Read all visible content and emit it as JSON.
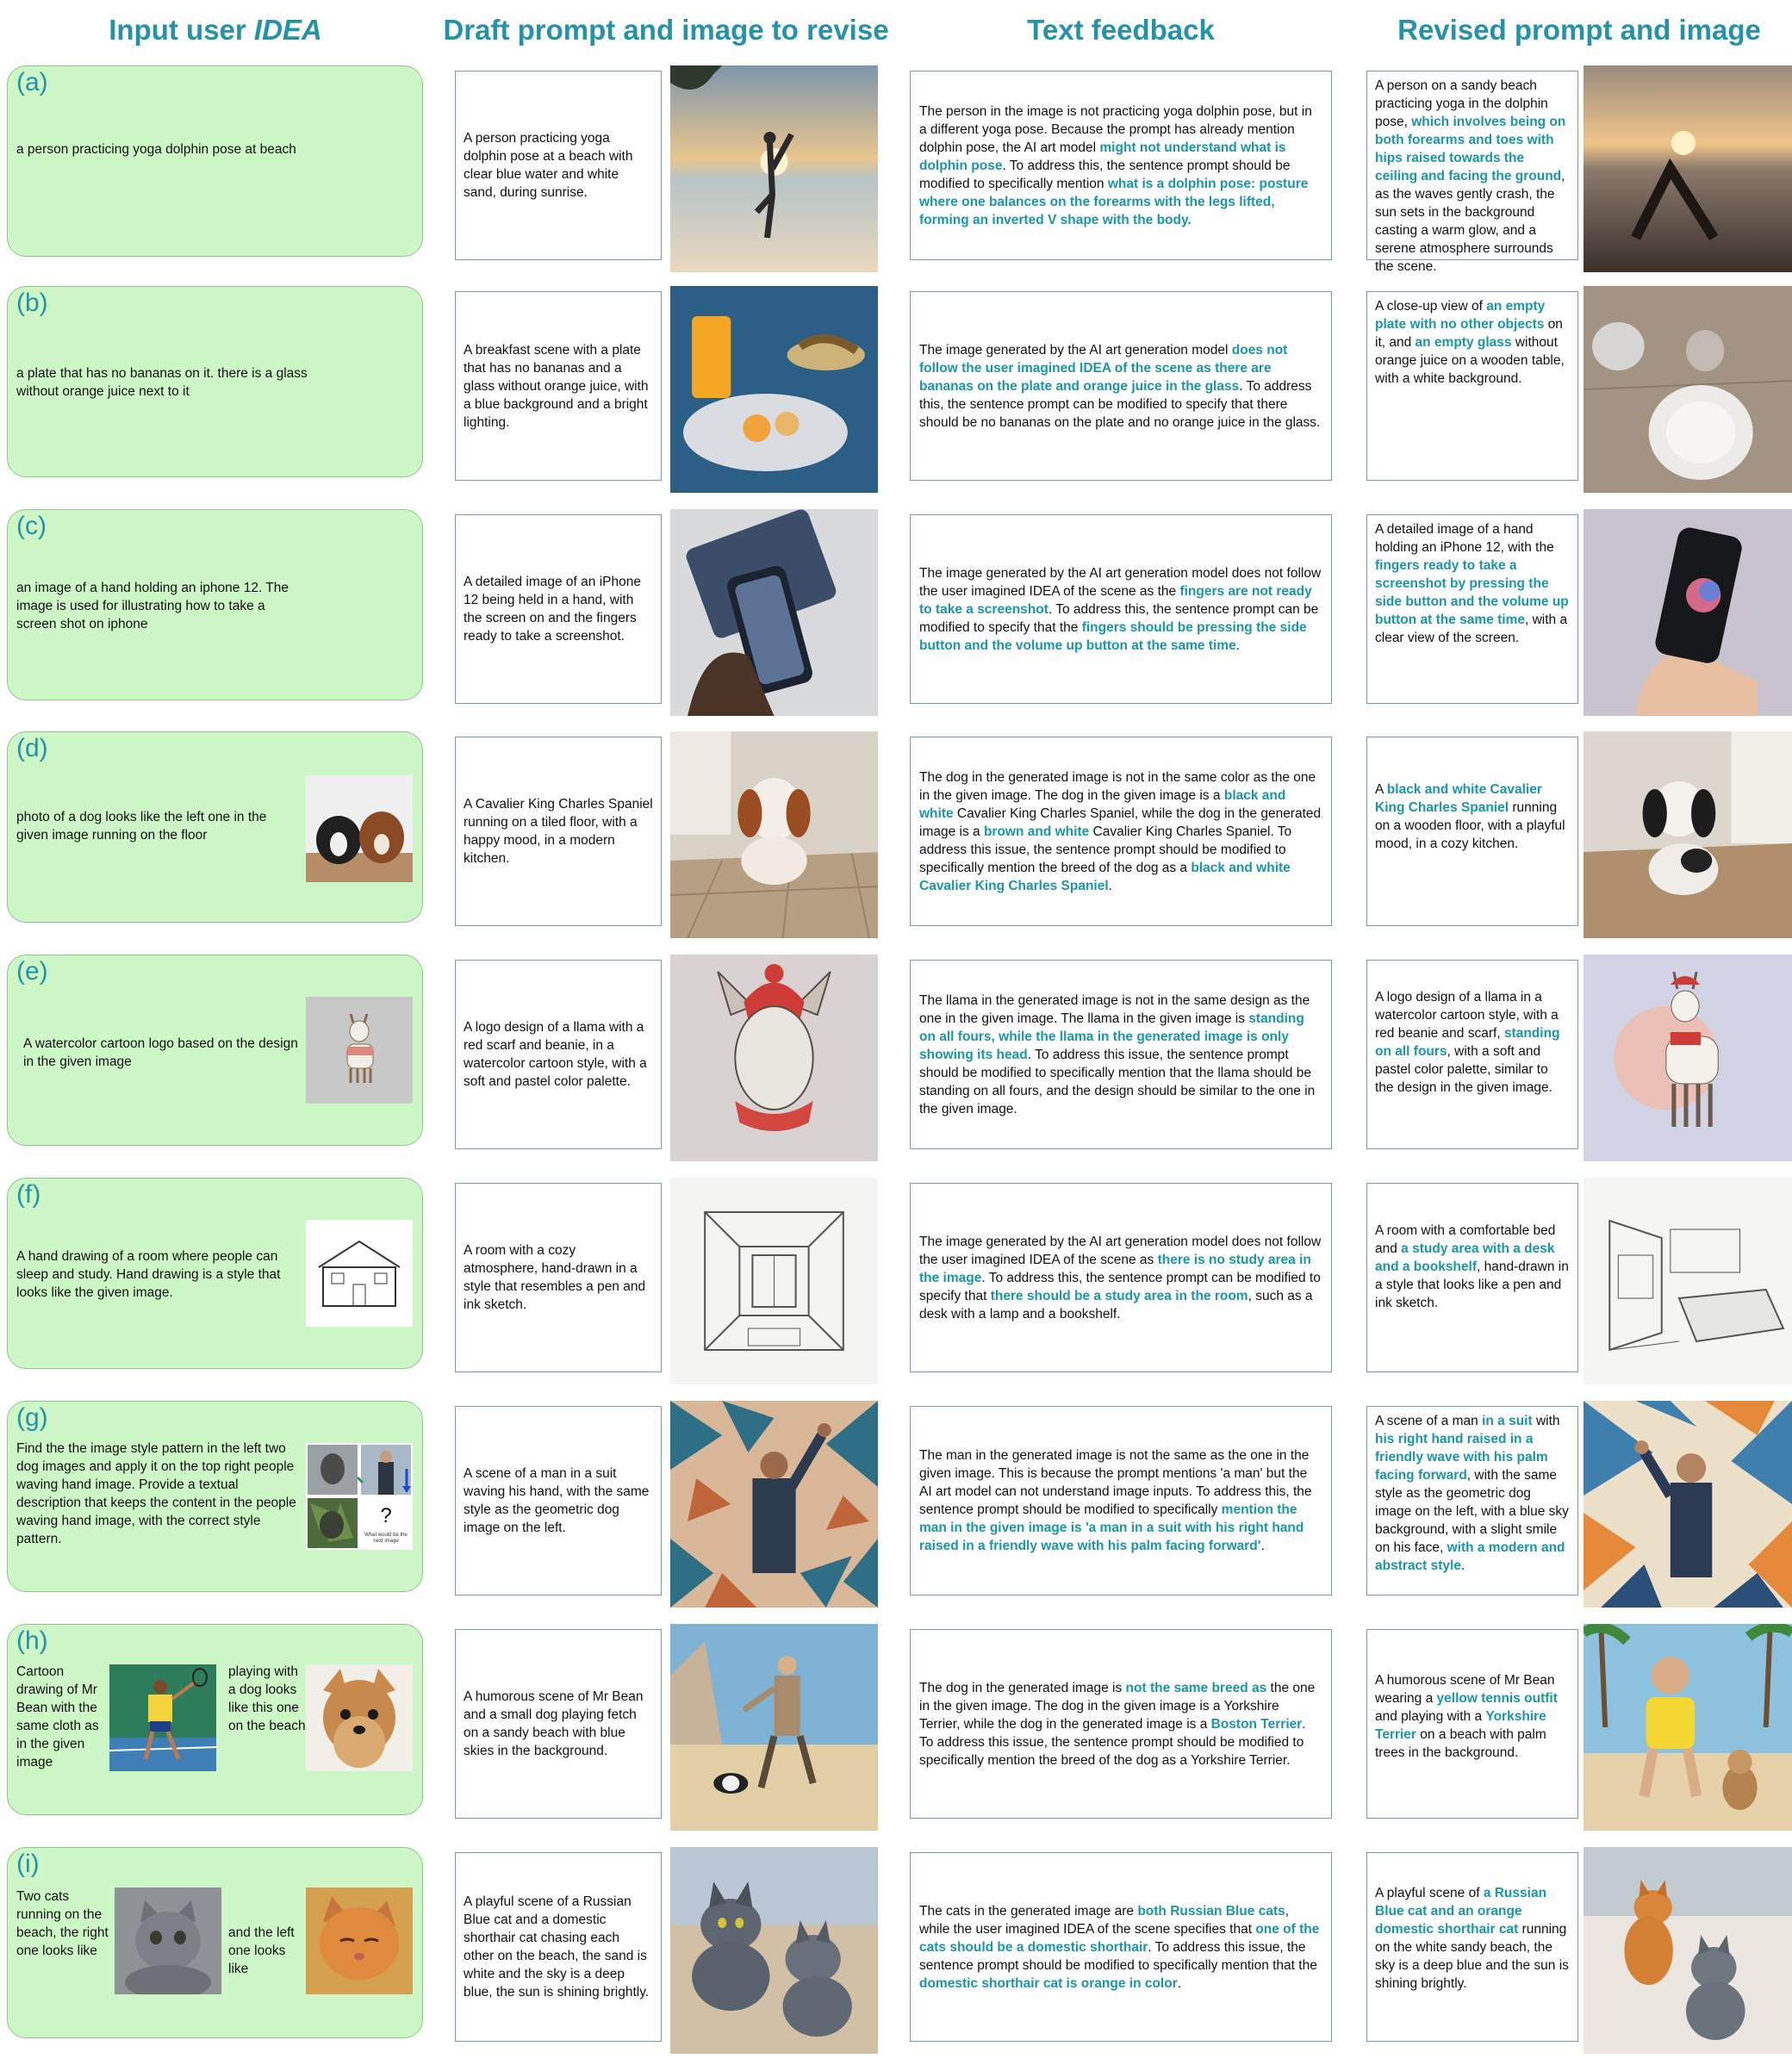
{
  "headers": {
    "col1_prefix": "Input user ",
    "col1_italic": "IDEA",
    "col2": "Draft prompt and image to revise",
    "col3": "Text feedback",
    "col4": "Revised prompt and image"
  },
  "rows": [
    {
      "label": "(a)",
      "idea": "a person practicing yoga dolphin pose at beach",
      "draft": "A person practicing yoga dolphin pose at a beach with clear blue water and white sand, during sunrise.",
      "feedback": [
        {
          "t": "The person in the image is not practicing yoga dolphin pose, but in a different yoga pose. Because the prompt has already mention dolphin pose, the AI art model ",
          "h": false
        },
        {
          "t": "might not understand what is dolphin pose",
          "h": true
        },
        {
          "t": ". To address this, the sentence prompt should be modified to specifically mention ",
          "h": false
        },
        {
          "t": "what is a dolphin pose: posture where one balances on the forearms with the legs lifted, forming an inverted V shape with the body.",
          "h": true
        }
      ],
      "revised": [
        {
          "t": "A person on a sandy beach practicing yoga in the dolphin pose, ",
          "h": false
        },
        {
          "t": "which involves being on both forearms and toes with hips raised towards the ceiling and facing the ground",
          "h": true
        },
        {
          "t": ", as the waves gently crash, the sun sets in the background casting a warm glow, and a serene atmosphere surrounds the scene.",
          "h": false
        }
      ]
    },
    {
      "label": "(b)",
      "idea": "a plate that has no bananas on it. there is a glass without orange juice next to it",
      "draft": "A breakfast scene with a plate that has no bananas and a glass without orange juice, with a blue background and a bright lighting.",
      "feedback": [
        {
          "t": "The image generated by the AI art generation model ",
          "h": false
        },
        {
          "t": "does not follow the user imagined IDEA of the scene as there are bananas on the plate and orange juice in the glass",
          "h": true
        },
        {
          "t": ". To address this, the sentence prompt can be modified to specify that there should be no bananas on the plate and no orange juice in the glass.",
          "h": false
        }
      ],
      "revised": [
        {
          "t": "A close-up view of ",
          "h": false
        },
        {
          "t": "an empty plate with no other objects",
          "h": true
        },
        {
          "t": " on it, and ",
          "h": false
        },
        {
          "t": "an empty glass",
          "h": true
        },
        {
          "t": " without orange juice on a wooden table, with a white background.",
          "h": false
        }
      ]
    },
    {
      "label": "(c)",
      "idea": "an image of a hand holding an iphone 12. The image is used for illustrating how to take a screen shot on iphone",
      "draft": "A detailed image of an iPhone 12 being held in a hand, with the screen on and the fingers ready to take a screenshot.",
      "feedback": [
        {
          "t": "The image generated by the AI art generation model does not follow the user imagined IDEA of the scene as the ",
          "h": false
        },
        {
          "t": "fingers are not ready to take a screenshot",
          "h": true
        },
        {
          "t": ". To address this, the sentence prompt can be modified to specify that the ",
          "h": false
        },
        {
          "t": "fingers should be pressing the side button and the volume up button at the same time",
          "h": true
        },
        {
          "t": ".",
          "h": false
        }
      ],
      "revised": [
        {
          "t": "A detailed image of a hand holding an iPhone 12, with the ",
          "h": false
        },
        {
          "t": "fingers ready to take a screenshot by pressing the side button and the volume up button at the same time",
          "h": true
        },
        {
          "t": ", with a clear view of the screen.",
          "h": false
        }
      ]
    },
    {
      "label": "(d)",
      "idea": "photo of a dog looks like the left one in the given image running on the floor",
      "draft": "A Cavalier King Charles Spaniel running on a tiled floor, with a happy mood, in a modern kitchen.",
      "feedback": [
        {
          "t": "The dog in the generated image is not in the same color as the one in the given image. The dog in the given image is a ",
          "h": false
        },
        {
          "t": "black and white",
          "h": true
        },
        {
          "t": " Cavalier King Charles Spaniel, while the dog in the generated image is a ",
          "h": false
        },
        {
          "t": "brown and white",
          "h": true
        },
        {
          "t": " Cavalier King Charles Spaniel. To address this issue, the sentence prompt should be modified to specifically mention the breed of the dog as a ",
          "h": false
        },
        {
          "t": "black and white Cavalier King Charles Spaniel",
          "h": true
        },
        {
          "t": ".",
          "h": false
        }
      ],
      "revised": [
        {
          "t": "A ",
          "h": false
        },
        {
          "t": "black and white Cavalier King Charles Spaniel",
          "h": true
        },
        {
          "t": " running on a wooden floor, with a playful mood, in a cozy kitchen.",
          "h": false
        }
      ]
    },
    {
      "label": "(e)",
      "idea": "A watercolor cartoon logo based on the design in the given image",
      "draft": "A logo design of a llama with a red scarf and beanie, in a watercolor cartoon style, with a soft and pastel color palette.",
      "feedback": [
        {
          "t": "The llama in the generated image is not in the same design as the one in the given image. The llama in the given image is ",
          "h": false
        },
        {
          "t": "standing on all fours, while the llama in the generated image is only showing its head",
          "h": true
        },
        {
          "t": ". To address this issue, the sentence prompt should be modified to specifically mention that the llama should be standing on all fours, and the design should be similar to the one in the given image.",
          "h": false
        }
      ],
      "revised": [
        {
          "t": "A logo design of a llama in a watercolor cartoon style, with a red beanie and scarf, ",
          "h": false
        },
        {
          "t": "standing on all fours",
          "h": true
        },
        {
          "t": ", with a soft and pastel color palette, similar to the design in the given image.",
          "h": false
        }
      ]
    },
    {
      "label": "(f)",
      "idea": "A hand drawing of a room where people can sleep and study. Hand drawing is a style that looks like the given image.",
      "draft": "A room with a cozy atmosphere, hand-drawn in a style that resembles a pen and ink sketch.",
      "feedback": [
        {
          "t": "The image generated by the AI art generation model does not follow the user imagined IDEA of the scene as ",
          "h": false
        },
        {
          "t": "there is no study area in the image",
          "h": true
        },
        {
          "t": ". To address this, the sentence prompt can be modified to specify that ",
          "h": false
        },
        {
          "t": "there should be a study area in the room",
          "h": true
        },
        {
          "t": ", such as a desk with a lamp and a bookshelf.",
          "h": false
        }
      ],
      "revised": [
        {
          "t": "A room with a comfortable bed and ",
          "h": false
        },
        {
          "t": "a study area with a desk and a bookshelf",
          "h": true
        },
        {
          "t": ", hand-drawn in a style that looks like a pen and ink sketch.",
          "h": false
        }
      ]
    },
    {
      "label": "(g)",
      "idea": "Find the the image style pattern in the left two dog images and apply it on the top right people waving hand image. Provide a textual description that keeps the content in the people waving hand image, with the correct style pattern.",
      "puzzle_mark": "?",
      "puzzle_caption": "What would be the next image",
      "draft": "A scene of a man in a suit waving his hand, with the same style as the geometric dog image on the left.",
      "feedback": [
        {
          "t": "The man in the generated image is not the same as the one in the given image. This is because the prompt mentions 'a man' but the AI art model can not understand image inputs. To address this, the sentence prompt should be modified to specifically ",
          "h": false
        },
        {
          "t": "mention the man in the given image is 'a man in a suit with his right hand raised in a friendly wave with his palm facing forward'",
          "h": true
        },
        {
          "t": ".",
          "h": false
        }
      ],
      "revised": [
        {
          "t": "A scene of a man ",
          "h": false
        },
        {
          "t": "in a suit",
          "h": true
        },
        {
          "t": " with ",
          "h": false
        },
        {
          "t": "his right hand raised in a friendly wave with his palm facing forward",
          "h": true
        },
        {
          "t": ", with the same style as the geometric dog image on the left, with a blue sky background, with a slight smile on his face, ",
          "h": false
        },
        {
          "t": "with a modern and abstract style",
          "h": true
        },
        {
          "t": ".",
          "h": false
        }
      ]
    },
    {
      "label": "(h)",
      "idea": "Cartoon drawing of Mr Bean with the same cloth as in the given image",
      "idea2": "playing with a dog looks like this one on the beach",
      "draft": "A humorous scene of Mr Bean and a small dog playing fetch on a sandy beach with blue skies in the background.",
      "feedback": [
        {
          "t": "The dog in the generated image is ",
          "h": false
        },
        {
          "t": "not the same breed as",
          "h": true
        },
        {
          "t": " the one in the given image. The dog in the given image is a Yorkshire Terrier, while the dog in the generated image is a ",
          "h": false
        },
        {
          "t": "Boston Terrier",
          "h": true
        },
        {
          "t": ". To address this issue, the sentence prompt should be modified to specifically mention the breed of the dog as a Yorkshire Terrier.",
          "h": false
        }
      ],
      "revised": [
        {
          "t": "A humorous scene of Mr Bean wearing a ",
          "h": false
        },
        {
          "t": "yellow tennis outfit",
          "h": true
        },
        {
          "t": " and playing with a ",
          "h": false
        },
        {
          "t": "Yorkshire Terrier",
          "h": true
        },
        {
          "t": " on a beach with palm trees in the background.",
          "h": false
        }
      ]
    },
    {
      "label": "(i)",
      "idea": "Two cats running on the beach, the right one looks like",
      "idea2": "and the left one looks like",
      "draft": "A playful scene of a Russian Blue cat and a domestic shorthair cat chasing each other on the beach, the sand is white and the sky is a deep blue, the sun is shining brightly.",
      "feedback": [
        {
          "t": "The cats in the generated image are ",
          "h": false
        },
        {
          "t": "both Russian Blue cats",
          "h": true
        },
        {
          "t": ", while the user imagined IDEA of the scene specifies that ",
          "h": false
        },
        {
          "t": "one of the cats should be a domestic shorthair",
          "h": true
        },
        {
          "t": ". To address this issue, the sentence prompt should be modified to specifically mention that the ",
          "h": false
        },
        {
          "t": "domestic shorthair cat is orange in color",
          "h": true
        },
        {
          "t": ".",
          "h": false
        }
      ],
      "revised": [
        {
          "t": "A playful scene of ",
          "h": false
        },
        {
          "t": "a Russian Blue cat and an orange domestic shorthair cat",
          "h": true
        },
        {
          "t": " running on the white sandy beach, the sky is a deep blue and the sun is shining brightly.",
          "h": false
        }
      ]
    }
  ]
}
